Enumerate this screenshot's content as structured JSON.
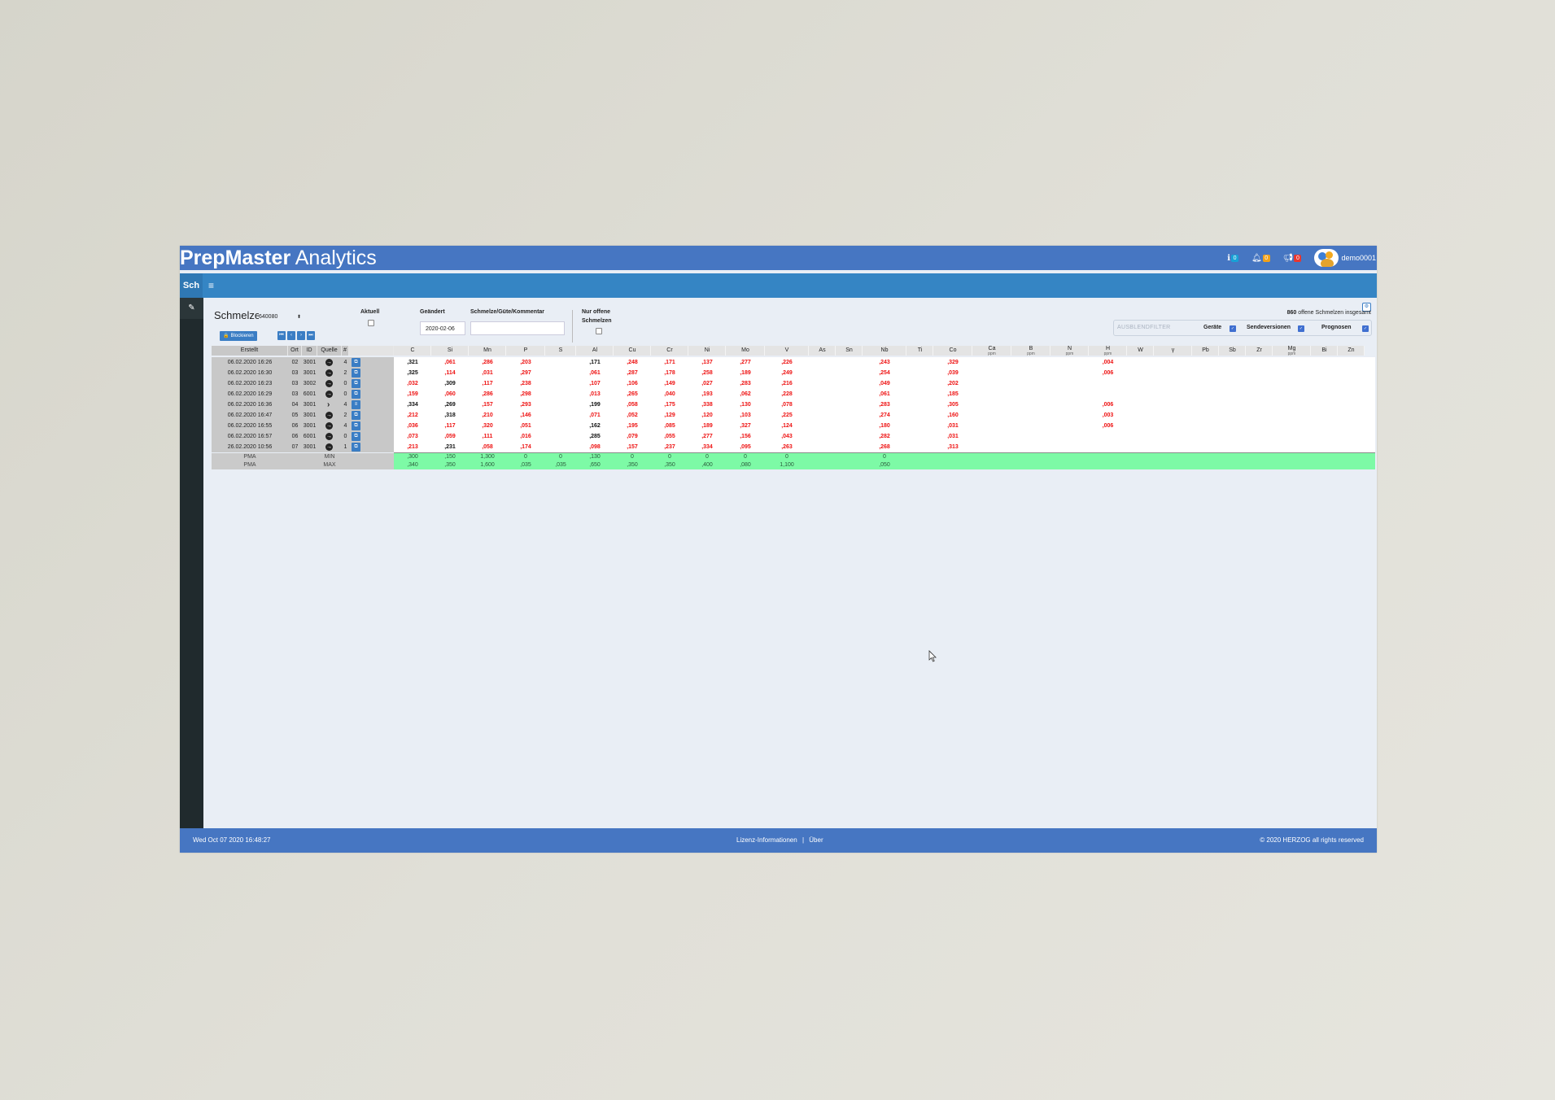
{
  "brand": {
    "bold": "PrepMaster",
    "light": " Analytics"
  },
  "topbar": {
    "info_count": "0",
    "bell_count": "0",
    "alert_count": "0",
    "username": "demo0001"
  },
  "subbar": {
    "tag": "Sch",
    "menu_icon": "≡"
  },
  "sidebar": {
    "pin_icon": "pin-icon"
  },
  "filters": {
    "title": "Schmelze",
    "schmelze_select": "640080",
    "block_button": "🔒 Blockieren",
    "aktuell_label": "Aktuell",
    "geaendert_label": "Geändert",
    "geaendert_value": "2020-02-06",
    "kommentar_label": "Schmelze/Güte/Kommentar",
    "nur_offene_label_1": "Nur offene",
    "nur_offene_label_2": "Schmelzen",
    "count_number": "860",
    "count_text": " offene Schmelzen insgesamt",
    "ausblend_placeholder": "AUSBLENDFILTER",
    "opt_geraete": "Geräte",
    "opt_sendeversionen": "Sendeversionen",
    "opt_prognosen": "Prognosen"
  },
  "table": {
    "left_headers": [
      "Erstellt",
      "Ort",
      "ID",
      "Quelle",
      "#"
    ],
    "elements": [
      {
        "name": "C"
      },
      {
        "name": "Si"
      },
      {
        "name": "Mn"
      },
      {
        "name": "P"
      },
      {
        "name": "S"
      },
      {
        "name": "Al"
      },
      {
        "name": "Cu"
      },
      {
        "name": "Cr"
      },
      {
        "name": "Ni"
      },
      {
        "name": "Mo"
      },
      {
        "name": "V"
      },
      {
        "name": "As"
      },
      {
        "name": "Sn"
      },
      {
        "name": "Nb"
      },
      {
        "name": "Ti"
      },
      {
        "name": "Co"
      },
      {
        "name": "Ca",
        "unit": "ppm"
      },
      {
        "name": "B",
        "unit": "ppm"
      },
      {
        "name": "N",
        "unit": "ppm"
      },
      {
        "name": "H",
        "unit": "ppm"
      },
      {
        "name": "W"
      },
      {
        "name": "γ"
      },
      {
        "name": "Pb"
      },
      {
        "name": "Sb"
      },
      {
        "name": "Zr"
      },
      {
        "name": "Mg",
        "unit": "ppm"
      },
      {
        "name": "Bi"
      },
      {
        "name": "Zn"
      }
    ],
    "rows": [
      {
        "erstellt": "06.02.2020 16:26",
        "ort": "02",
        "id": "3001",
        "quelle": "arrow",
        "count": "4",
        "v": [
          {
            "t": ",321",
            "c": "k"
          },
          {
            "t": ",061",
            "c": "r"
          },
          {
            "t": ",286",
            "c": "r"
          },
          {
            "t": ",203",
            "c": "r"
          },
          {
            "t": "",
            "c": ""
          },
          {
            "t": ",171",
            "c": "k"
          },
          {
            "t": ",248",
            "c": "r"
          },
          {
            "t": ",171",
            "c": "r"
          },
          {
            "t": ",137",
            "c": "r"
          },
          {
            "t": ",277",
            "c": "r"
          },
          {
            "t": ",226",
            "c": "r"
          },
          {
            "t": "",
            "c": ""
          },
          {
            "t": "",
            "c": ""
          },
          {
            "t": ",243",
            "c": "r"
          },
          {
            "t": "",
            "c": ""
          },
          {
            "t": ",329",
            "c": "r"
          },
          {
            "t": "",
            "c": ""
          },
          {
            "t": "",
            "c": ""
          },
          {
            "t": "",
            "c": ""
          },
          {
            "t": ",004",
            "c": "r"
          }
        ]
      },
      {
        "erstellt": "06.02.2020 16:30",
        "ort": "03",
        "id": "3001",
        "quelle": "arrow",
        "count": "2",
        "v": [
          {
            "t": ",325",
            "c": "k"
          },
          {
            "t": ",114",
            "c": "r"
          },
          {
            "t": ",031",
            "c": "r"
          },
          {
            "t": ",297",
            "c": "r"
          },
          {
            "t": "",
            "c": ""
          },
          {
            "t": ",061",
            "c": "r"
          },
          {
            "t": ",287",
            "c": "r"
          },
          {
            "t": ",178",
            "c": "r"
          },
          {
            "t": ",258",
            "c": "r"
          },
          {
            "t": ",189",
            "c": "r"
          },
          {
            "t": ",249",
            "c": "r"
          },
          {
            "t": "",
            "c": ""
          },
          {
            "t": "",
            "c": ""
          },
          {
            "t": ",254",
            "c": "r"
          },
          {
            "t": "",
            "c": ""
          },
          {
            "t": ",039",
            "c": "r"
          },
          {
            "t": "",
            "c": ""
          },
          {
            "t": "",
            "c": ""
          },
          {
            "t": "",
            "c": ""
          },
          {
            "t": ",006",
            "c": "r"
          }
        ]
      },
      {
        "erstellt": "06.02.2020 16:23",
        "ort": "03",
        "id": "3002",
        "quelle": "arrow",
        "count": "0",
        "v": [
          {
            "t": ",032",
            "c": "r"
          },
          {
            "t": ",309",
            "c": "k"
          },
          {
            "t": ",117",
            "c": "r"
          },
          {
            "t": ",238",
            "c": "r"
          },
          {
            "t": "",
            "c": ""
          },
          {
            "t": ",107",
            "c": "r"
          },
          {
            "t": ",106",
            "c": "r"
          },
          {
            "t": ",149",
            "c": "r"
          },
          {
            "t": ",027",
            "c": "r"
          },
          {
            "t": ",283",
            "c": "r"
          },
          {
            "t": ",216",
            "c": "r"
          },
          {
            "t": "",
            "c": ""
          },
          {
            "t": "",
            "c": ""
          },
          {
            "t": ",049",
            "c": "r"
          },
          {
            "t": "",
            "c": ""
          },
          {
            "t": ",202",
            "c": "r"
          },
          {
            "t": "",
            "c": ""
          },
          {
            "t": "",
            "c": ""
          },
          {
            "t": "",
            "c": ""
          },
          {
            "t": "",
            "c": ""
          }
        ]
      },
      {
        "erstellt": "06.02.2020 16:29",
        "ort": "03",
        "id": "6001",
        "quelle": "arrow",
        "count": "0",
        "v": [
          {
            "t": ",159",
            "c": "r"
          },
          {
            "t": ",060",
            "c": "r"
          },
          {
            "t": ",286",
            "c": "r"
          },
          {
            "t": ",298",
            "c": "r"
          },
          {
            "t": "",
            "c": ""
          },
          {
            "t": ",013",
            "c": "r"
          },
          {
            "t": ",265",
            "c": "r"
          },
          {
            "t": ",040",
            "c": "r"
          },
          {
            "t": ",193",
            "c": "r"
          },
          {
            "t": ",062",
            "c": "r"
          },
          {
            "t": ",228",
            "c": "r"
          },
          {
            "t": "",
            "c": ""
          },
          {
            "t": "",
            "c": ""
          },
          {
            "t": ",061",
            "c": "r"
          },
          {
            "t": "",
            "c": ""
          },
          {
            "t": ",185",
            "c": "r"
          },
          {
            "t": "",
            "c": ""
          },
          {
            "t": "",
            "c": ""
          },
          {
            "t": "",
            "c": ""
          },
          {
            "t": "",
            "c": ""
          }
        ]
      },
      {
        "erstellt": "06.02.2020 16:36",
        "ort": "04",
        "id": "3001",
        "quelle": "chevron",
        "count": "4",
        "v": [
          {
            "t": ",334",
            "c": "k"
          },
          {
            "t": ",269",
            "c": "k"
          },
          {
            "t": ",157",
            "c": "r"
          },
          {
            "t": ",293",
            "c": "r"
          },
          {
            "t": "",
            "c": ""
          },
          {
            "t": ",199",
            "c": "k"
          },
          {
            "t": ",058",
            "c": "r"
          },
          {
            "t": ",175",
            "c": "r"
          },
          {
            "t": ",338",
            "c": "r"
          },
          {
            "t": ",130",
            "c": "r"
          },
          {
            "t": ",078",
            "c": "r"
          },
          {
            "t": "",
            "c": ""
          },
          {
            "t": "",
            "c": ""
          },
          {
            "t": ",283",
            "c": "r"
          },
          {
            "t": "",
            "c": ""
          },
          {
            "t": ",305",
            "c": "r"
          },
          {
            "t": "",
            "c": ""
          },
          {
            "t": "",
            "c": ""
          },
          {
            "t": "",
            "c": ""
          },
          {
            "t": ",006",
            "c": "r"
          }
        ]
      },
      {
        "erstellt": "06.02.2020 16:47",
        "ort": "05",
        "id": "3001",
        "quelle": "arrow",
        "count": "2",
        "v": [
          {
            "t": ",212",
            "c": "r"
          },
          {
            "t": ",318",
            "c": "k"
          },
          {
            "t": ",210",
            "c": "r"
          },
          {
            "t": ",146",
            "c": "r"
          },
          {
            "t": "",
            "c": ""
          },
          {
            "t": ",071",
            "c": "r"
          },
          {
            "t": ",052",
            "c": "r"
          },
          {
            "t": ",129",
            "c": "r"
          },
          {
            "t": ",120",
            "c": "r"
          },
          {
            "t": ",103",
            "c": "r"
          },
          {
            "t": ",225",
            "c": "r"
          },
          {
            "t": "",
            "c": ""
          },
          {
            "t": "",
            "c": ""
          },
          {
            "t": ",274",
            "c": "r"
          },
          {
            "t": "",
            "c": ""
          },
          {
            "t": ",160",
            "c": "r"
          },
          {
            "t": "",
            "c": ""
          },
          {
            "t": "",
            "c": ""
          },
          {
            "t": "",
            "c": ""
          },
          {
            "t": ",003",
            "c": "r"
          }
        ]
      },
      {
        "erstellt": "06.02.2020 16:55",
        "ort": "06",
        "id": "3001",
        "quelle": "arrow",
        "count": "4",
        "v": [
          {
            "t": ",036",
            "c": "r"
          },
          {
            "t": ",117",
            "c": "r"
          },
          {
            "t": ",320",
            "c": "r"
          },
          {
            "t": ",051",
            "c": "r"
          },
          {
            "t": "",
            "c": ""
          },
          {
            "t": ",162",
            "c": "k"
          },
          {
            "t": ",195",
            "c": "r"
          },
          {
            "t": ",085",
            "c": "r"
          },
          {
            "t": ",189",
            "c": "r"
          },
          {
            "t": ",327",
            "c": "r"
          },
          {
            "t": ",124",
            "c": "r"
          },
          {
            "t": "",
            "c": ""
          },
          {
            "t": "",
            "c": ""
          },
          {
            "t": ",180",
            "c": "r"
          },
          {
            "t": "",
            "c": ""
          },
          {
            "t": ",031",
            "c": "r"
          },
          {
            "t": "",
            "c": ""
          },
          {
            "t": "",
            "c": ""
          },
          {
            "t": "",
            "c": ""
          },
          {
            "t": ",006",
            "c": "r"
          }
        ]
      },
      {
        "erstellt": "06.02.2020 16:57",
        "ort": "06",
        "id": "6001",
        "quelle": "arrow",
        "count": "0",
        "v": [
          {
            "t": ",073",
            "c": "r"
          },
          {
            "t": ",059",
            "c": "r"
          },
          {
            "t": ",111",
            "c": "r"
          },
          {
            "t": ",016",
            "c": "r"
          },
          {
            "t": "",
            "c": ""
          },
          {
            "t": ",285",
            "c": "k"
          },
          {
            "t": ",079",
            "c": "r"
          },
          {
            "t": ",055",
            "c": "r"
          },
          {
            "t": ",277",
            "c": "r"
          },
          {
            "t": ",156",
            "c": "r"
          },
          {
            "t": ",043",
            "c": "r"
          },
          {
            "t": "",
            "c": ""
          },
          {
            "t": "",
            "c": ""
          },
          {
            "t": ",282",
            "c": "r"
          },
          {
            "t": "",
            "c": ""
          },
          {
            "t": ",031",
            "c": "r"
          },
          {
            "t": "",
            "c": ""
          },
          {
            "t": "",
            "c": ""
          },
          {
            "t": "",
            "c": ""
          },
          {
            "t": "",
            "c": ""
          }
        ]
      },
      {
        "erstellt": "26.02.2020 10:56",
        "ort": "07",
        "id": "3001",
        "quelle": "arrow",
        "count": "1",
        "v": [
          {
            "t": ",213",
            "c": "r"
          },
          {
            "t": ",231",
            "c": "k"
          },
          {
            "t": ",058",
            "c": "r"
          },
          {
            "t": ",174",
            "c": "r"
          },
          {
            "t": "",
            "c": ""
          },
          {
            "t": ",098",
            "c": "r"
          },
          {
            "t": ",157",
            "c": "r"
          },
          {
            "t": ",237",
            "c": "r"
          },
          {
            "t": ",334",
            "c": "r"
          },
          {
            "t": ",095",
            "c": "r"
          },
          {
            "t": ",263",
            "c": "r"
          },
          {
            "t": "",
            "c": ""
          },
          {
            "t": "",
            "c": ""
          },
          {
            "t": ",268",
            "c": "r"
          },
          {
            "t": "",
            "c": ""
          },
          {
            "t": ",313",
            "c": "r"
          },
          {
            "t": "",
            "c": ""
          },
          {
            "t": "",
            "c": ""
          },
          {
            "t": "",
            "c": ""
          },
          {
            "t": "",
            "c": ""
          }
        ]
      }
    ],
    "limits": [
      {
        "label": "PMA",
        "kind": "MIN",
        "v": [
          ",300",
          ",150",
          "1,300",
          "0",
          "0",
          ",130",
          "0",
          "0",
          "0",
          "0",
          "0",
          "",
          "",
          "0"
        ]
      },
      {
        "label": "PMA",
        "kind": "MAX",
        "v": [
          ",340",
          ",350",
          "1,600",
          ",035",
          ",035",
          ",650",
          ",350",
          ",350",
          ",400",
          ",080",
          "1,100",
          "",
          "",
          ",050"
        ]
      }
    ]
  },
  "footer": {
    "datetime": "Wed Oct 07 2020 16:48:27",
    "license": "Lizenz-Informationen",
    "pipe": "|",
    "about": "Über",
    "copyright": "© 2020 HERZOG all rights reserved"
  },
  "colors": {
    "primary": "#4676c2",
    "secondary": "#3585c4",
    "danger": "#e11111",
    "limits": "#7dfaa6"
  }
}
